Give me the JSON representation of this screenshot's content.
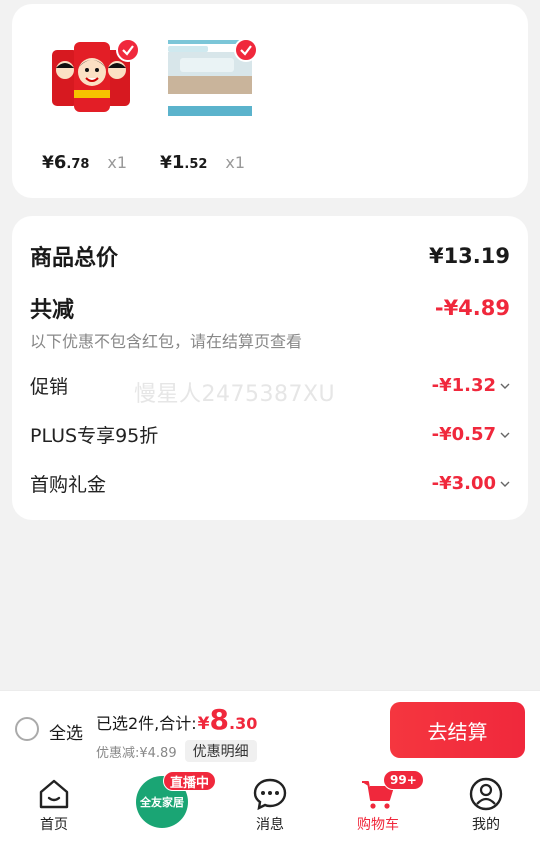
{
  "products": [
    {
      "name_icon": "wangzai-milk-cans-thumbnail",
      "price_yen": "¥",
      "price_int": "6",
      "price_dec": ".78",
      "qty": "x1"
    },
    {
      "name_icon": "tofu-package-thumbnail",
      "price_yen": "¥",
      "price_int": "1",
      "price_dec": ".52",
      "qty": "x1"
    }
  ],
  "summary": {
    "total_label": "商品总价",
    "total_value": "¥13.19",
    "reduce_label": "共减",
    "reduce_value": "-¥4.89",
    "reduce_note": "以下优惠不包含红包，请在结算页查看",
    "discounts": [
      {
        "label": "促销",
        "value": "-¥1.32"
      },
      {
        "label": "PLUS专享95折",
        "value": "-¥0.57"
      },
      {
        "label": "首购礼金",
        "value": "-¥3.00"
      }
    ],
    "watermark": "慢星人2475387XU"
  },
  "checkout": {
    "select_all": "全选",
    "selected_text": "已选2件,合计:",
    "total_yen": "¥",
    "total_int": "8",
    "total_dec": ".30",
    "discount_text": "优惠减:¥4.89",
    "detail_button": "优惠明细",
    "checkout_button": "去结算"
  },
  "tabbar": {
    "home": "首页",
    "live_circle": "全友家居",
    "live_badge": "直播中",
    "messages": "消息",
    "cart": "购物车",
    "cart_badge": "99+",
    "mine": "我的"
  },
  "colors": {
    "accent": "#f0283c",
    "live_green": "#1aa574"
  }
}
